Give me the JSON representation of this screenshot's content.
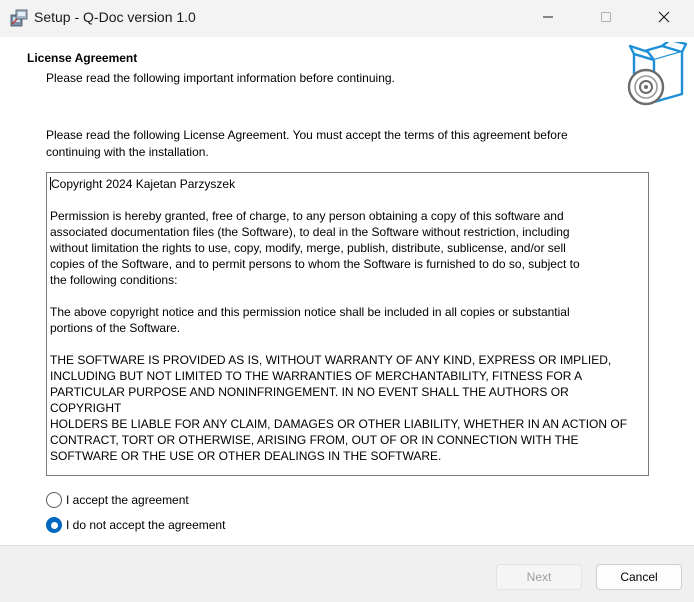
{
  "window": {
    "title": "Setup - Q-Doc version 1.0"
  },
  "header": {
    "title": "License Agreement",
    "subtitle": "Please read the following important information before continuing."
  },
  "main": {
    "intro_line1": "Please read the following License Agreement. You must accept the terms of this agreement before",
    "intro_line2": "continuing with the installation.",
    "license": {
      "p1": "Copyright 2024 Kajetan Parzyszek",
      "p2": "Permission is hereby granted, free of charge, to any person obtaining a copy of this software and\nassociated documentation files (the Software), to deal in the Software without restriction, including\nwithout limitation the rights to use, copy, modify, merge, publish, distribute, sublicense, and/or sell\ncopies of the Software, and to permit persons to whom the Software is furnished to do so, subject to\nthe following conditions:",
      "p3": "The above copyright notice and this permission notice shall be included in all copies or substantial\nportions of the Software.",
      "p4": "THE SOFTWARE IS PROVIDED AS IS, WITHOUT WARRANTY OF ANY KIND, EXPRESS OR IMPLIED,\nINCLUDING BUT NOT LIMITED TO THE WARRANTIES OF MERCHANTABILITY, FITNESS FOR A\nPARTICULAR PURPOSE AND NONINFRINGEMENT. IN NO EVENT SHALL THE AUTHORS OR COPYRIGHT\nHOLDERS BE LIABLE FOR ANY CLAIM, DAMAGES OR OTHER LIABILITY, WHETHER IN AN ACTION OF\nCONTRACT, TORT OR OTHERWISE, ARISING FROM, OUT OF OR IN CONNECTION WITH THE\nSOFTWARE OR THE USE OR OTHER DEALINGS IN THE SOFTWARE."
    },
    "accept_label": "I accept the agreement",
    "decline_label": "I do not accept the agreement",
    "selected_option": "decline"
  },
  "footer": {
    "next_label": "Next",
    "next_enabled": false,
    "cancel_label": "Cancel"
  },
  "colors": {
    "accent": "#0067c0",
    "disabled_text": "#9e9e9e"
  },
  "icons": {
    "app": "setup-installer-icon",
    "header": "box-with-disc-icon",
    "minimize": "minimize-icon",
    "maximize": "maximize-icon",
    "close": "close-icon"
  }
}
